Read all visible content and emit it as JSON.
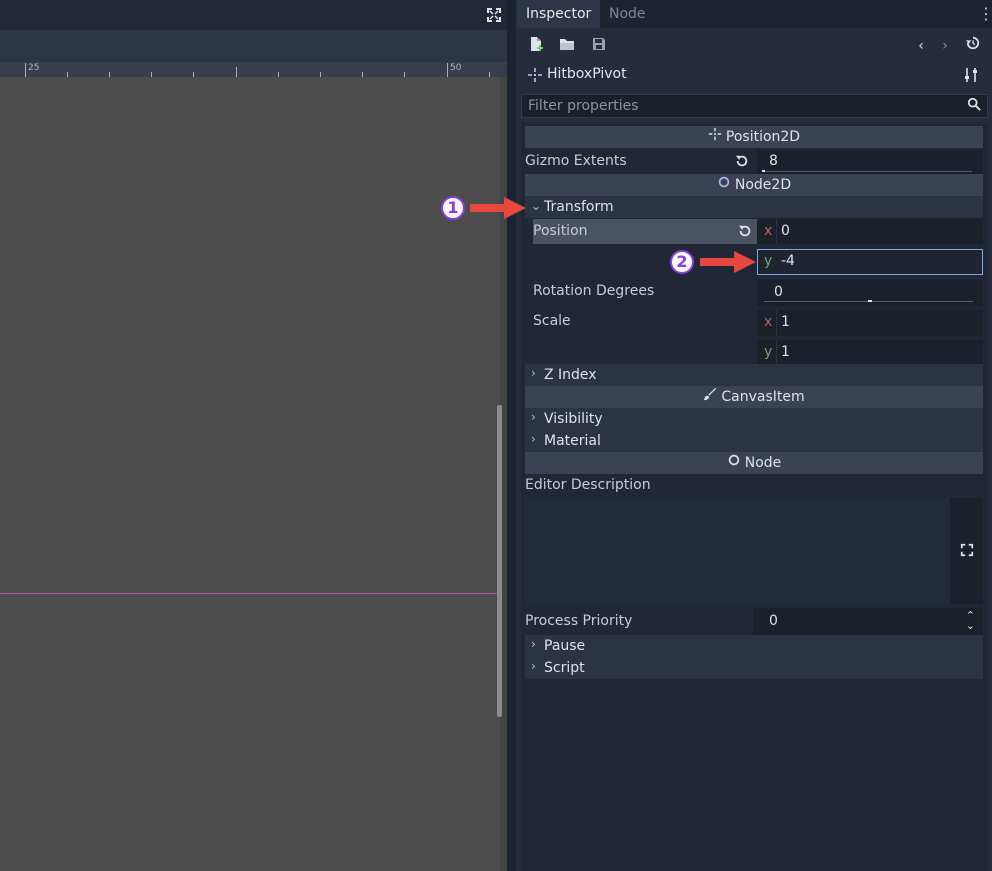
{
  "viewport": {
    "ruler_labels": [
      "25",
      "50"
    ],
    "fullscreen_icon": "expand-icon"
  },
  "dock": {
    "tabs": [
      {
        "label": "Inspector",
        "active": true
      },
      {
        "label": "Node",
        "active": false
      }
    ],
    "menu_icon": "kebab-menu-icon"
  },
  "inspector": {
    "toolbar_icons": [
      "new-resource-icon",
      "open-folder-icon",
      "save-icon",
      "history-back-icon",
      "history-forward-icon",
      "history-icon"
    ],
    "object_name": "HitboxPivot",
    "object_icon": "position2d-icon",
    "object_settings_icon": "tools-icon",
    "filter_placeholder": "Filter properties",
    "sections": {
      "position2d": "Position2D",
      "node2d": "Node2D",
      "canvas_item": "CanvasItem",
      "node": "Node"
    },
    "gizmo_extents": {
      "label": "Gizmo Extents",
      "value": "8"
    },
    "transform": {
      "group": "Transform",
      "position": {
        "label": "Position",
        "x": "0",
        "y": "-4"
      },
      "rotation": {
        "label": "Rotation Degrees",
        "value": "0"
      },
      "scale": {
        "label": "Scale",
        "x": "1",
        "y": "1"
      }
    },
    "z_index": "Z Index",
    "visibility": "Visibility",
    "material": "Material",
    "editor_description": {
      "label": "Editor Description",
      "value": ""
    },
    "process_priority": {
      "label": "Process Priority",
      "value": "0"
    },
    "pause": "Pause",
    "script": "Script",
    "axis_x": "x",
    "axis_y": "y"
  },
  "annotations": [
    {
      "number": "1"
    },
    {
      "number": "2"
    }
  ],
  "colors": {
    "arrow": "#e8473d",
    "callout_ring": "#8a3ce0",
    "guide_line": "#b44fb4"
  }
}
